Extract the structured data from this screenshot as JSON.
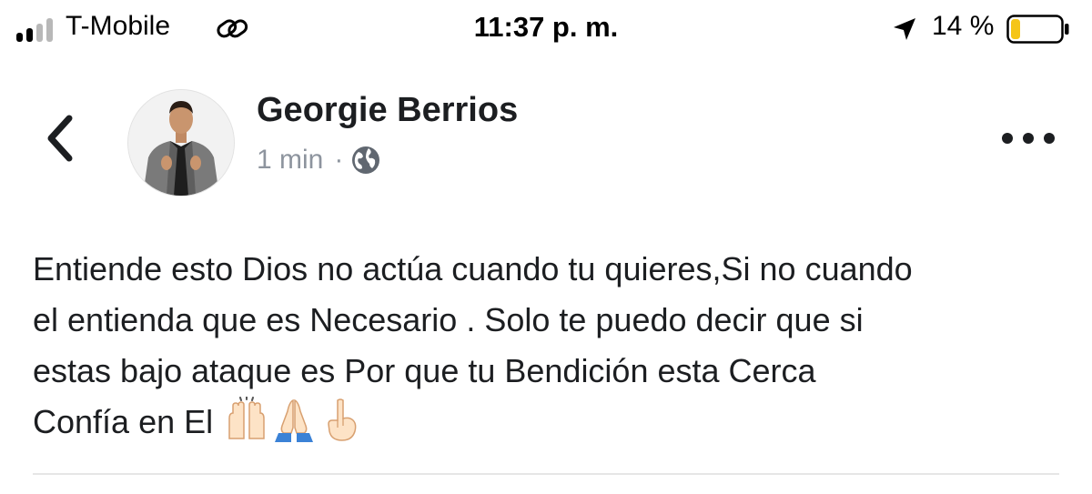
{
  "status_bar": {
    "carrier": "T-Mobile",
    "time": "11:37 p. m.",
    "battery_percent": "14 %",
    "battery_level": 0.14,
    "battery_color": "#f5c518",
    "signal_bars_filled": 2,
    "signal_bars_total": 4,
    "icons": [
      "signal-icon",
      "hotspot-icon",
      "location-arrow-icon",
      "battery-icon"
    ]
  },
  "header": {
    "back_icon": "chevron-left-icon",
    "author_name": "Georgie Berrios",
    "post_time": "1 min",
    "separator": "·",
    "privacy_icon": "globe-icon",
    "more_icon": "more-dots-icon"
  },
  "post": {
    "lines": [
      "Entiende esto Dios no actúa cuando tu quieres,Si no cuando",
      "el entienda que es Necesario . Solo te puedo decir que si",
      "estas bajo ataque es Por que tu Bendición esta Cerca",
      "Confía en El"
    ],
    "emojis": [
      "raising-hands-emoji",
      "folded-hands-emoji",
      "pointing-up-emoji"
    ]
  },
  "colors": {
    "text": "#1c1e21",
    "muted": "#8d949e",
    "divider": "#e6e6e6"
  }
}
